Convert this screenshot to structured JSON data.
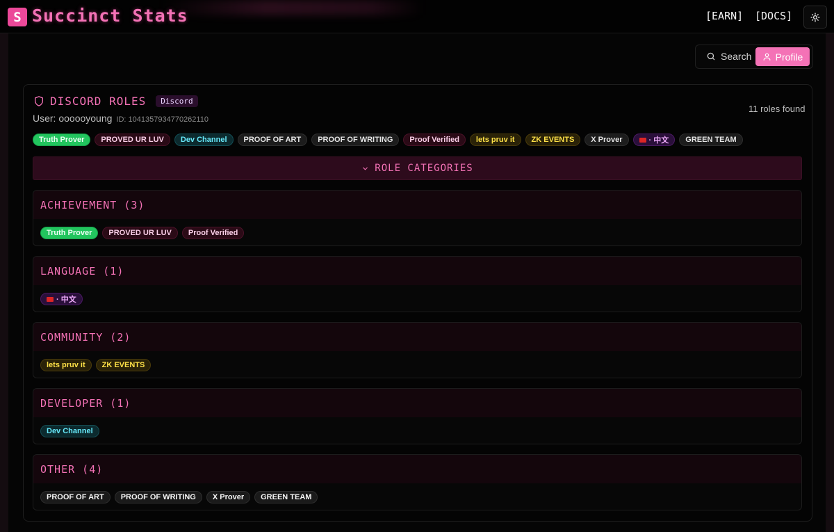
{
  "header": {
    "logo_letter": "S",
    "brand": "Succinct Stats",
    "nav": [
      "[EARN]",
      "[DOCS]"
    ],
    "theme_icon": "sun-icon"
  },
  "actions": {
    "search_label": "Search",
    "profile_label": "Profile",
    "search_icon": "search-icon",
    "profile_icon": "user-icon"
  },
  "card": {
    "title": "DISCORD ROLES",
    "badge": "Discord",
    "user_label": "User: oooooyoung",
    "user_id": "ID: 1041357934770262110",
    "roles_found": "11 roles found",
    "all_roles": [
      {
        "label": "Truth Prover",
        "style": "green"
      },
      {
        "label": "PROVED UR LUV",
        "style": "pink"
      },
      {
        "label": "Dev Channel",
        "style": "cyan"
      },
      {
        "label": "PROOF OF ART",
        "style": "gray"
      },
      {
        "label": "PROOF OF WRITING",
        "style": "gray"
      },
      {
        "label": "Proof Verified",
        "style": "pink"
      },
      {
        "label": "lets pruv it",
        "style": "yellow"
      },
      {
        "label": "ZK EVENTS",
        "style": "yellow"
      },
      {
        "label": "X Prover",
        "style": "gray"
      },
      {
        "label": "· 中文",
        "style": "purple"
      },
      {
        "label": "GREEN TEAM",
        "style": "gray"
      }
    ],
    "categories_label": "ROLE CATEGORIES",
    "sections": [
      {
        "title": "ACHIEVEMENT (3)",
        "roles": [
          "Truth Prover",
          "PROVED UR LUV",
          "Proof Verified"
        ]
      },
      {
        "title": "LANGUAGE (1)",
        "roles": [
          "· 中文"
        ]
      },
      {
        "title": "COMMUNITY (2)",
        "roles": [
          "lets pruv it",
          "ZK EVENTS"
        ]
      },
      {
        "title": "DEVELOPER (1)",
        "roles": [
          "Dev Channel"
        ]
      },
      {
        "title": "OTHER (4)",
        "roles": [
          "PROOF OF ART",
          "PROOF OF WRITING",
          "X Prover",
          "GREEN TEAM"
        ]
      }
    ]
  },
  "colors": {
    "accent": "#f472b6",
    "brand_pink": "#ec4899",
    "background": "#050505"
  }
}
